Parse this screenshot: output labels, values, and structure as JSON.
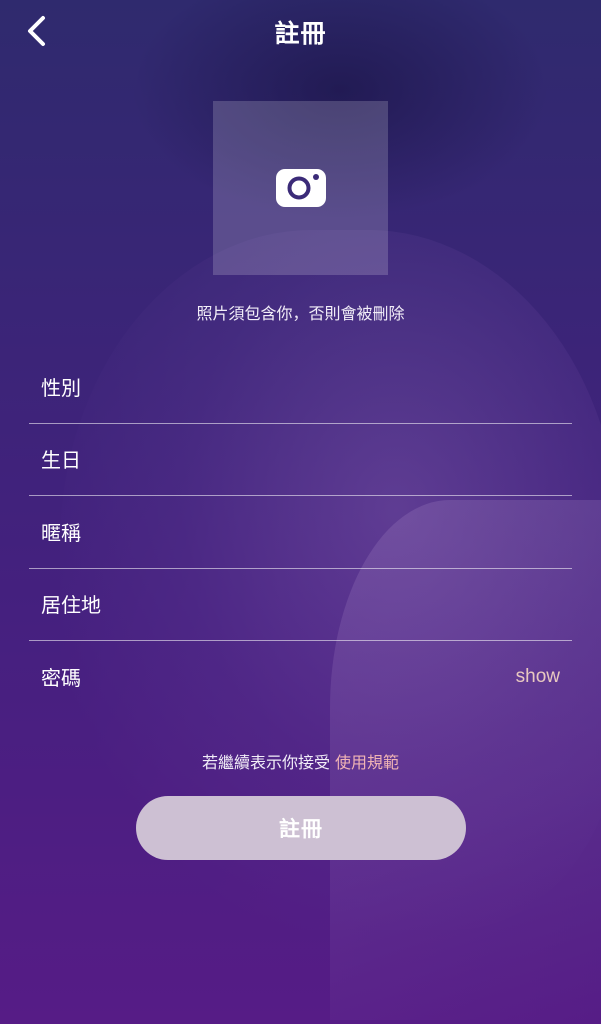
{
  "header": {
    "title": "註冊",
    "back_icon": "chevron-left-icon"
  },
  "photo": {
    "icon": "camera-icon",
    "hint": "照片須包含你，否則會被刪除"
  },
  "form": {
    "gender_label": "性別",
    "birthday_label": "生日",
    "nickname_label": "暱稱",
    "location_label": "居住地",
    "password_label": "密碼",
    "password_show": "show"
  },
  "terms": {
    "prefix": "若繼續表示你接受 ",
    "link": "使用規範"
  },
  "submit": {
    "label": "註冊"
  },
  "colors": {
    "accent_link": "#f0b4b4",
    "button_bg": "#cdc0d3",
    "show_text": "#e8c8c0"
  }
}
